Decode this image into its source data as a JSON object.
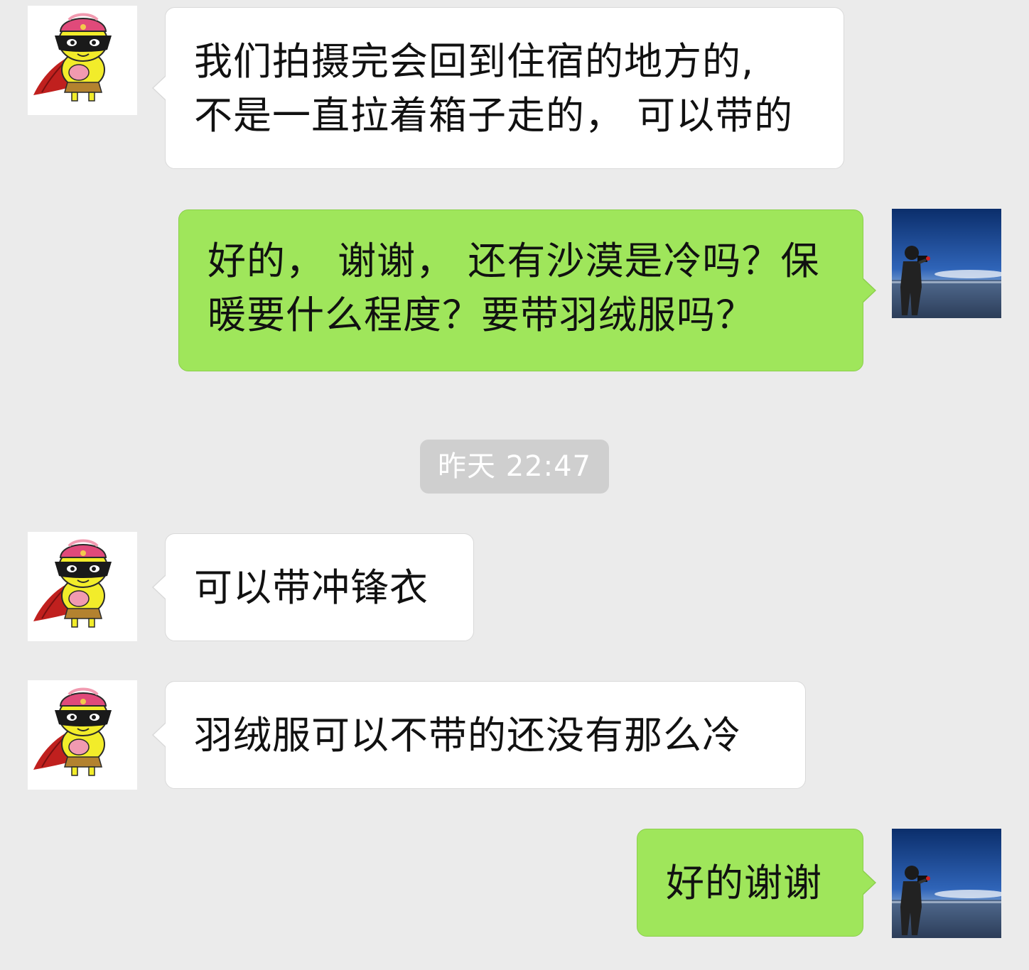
{
  "conversation": {
    "messages": [
      {
        "sender": "contact",
        "lines": [
          "我们拍摄完会回到住宿的地方的,",
          "不是一直拉着箱子走的， 可以带的"
        ]
      },
      {
        "sender": "me",
        "lines": [
          "好的， 谢谢， 还有沙漠是冷吗？保",
          "暖要什么程度？要带羽绒服吗？"
        ]
      },
      {
        "sender": "contact",
        "lines": [
          "可以带冲锋衣"
        ]
      },
      {
        "sender": "contact",
        "lines": [
          "羽绒服可以不带的还没有那么冷"
        ]
      },
      {
        "sender": "me",
        "lines": [
          "好的谢谢"
        ]
      }
    ],
    "timestamp": "昨天 22:47"
  },
  "colors": {
    "background": "#ebebeb",
    "incoming_bubble": "#ffffff",
    "outgoing_bubble": "#9fe65b",
    "timestamp_pill": "#cfcfcf"
  },
  "icons": {
    "contact_avatar": "cartoon-masked-hero-avatar-icon",
    "my_avatar": "photographer-landscape-avatar-icon"
  }
}
